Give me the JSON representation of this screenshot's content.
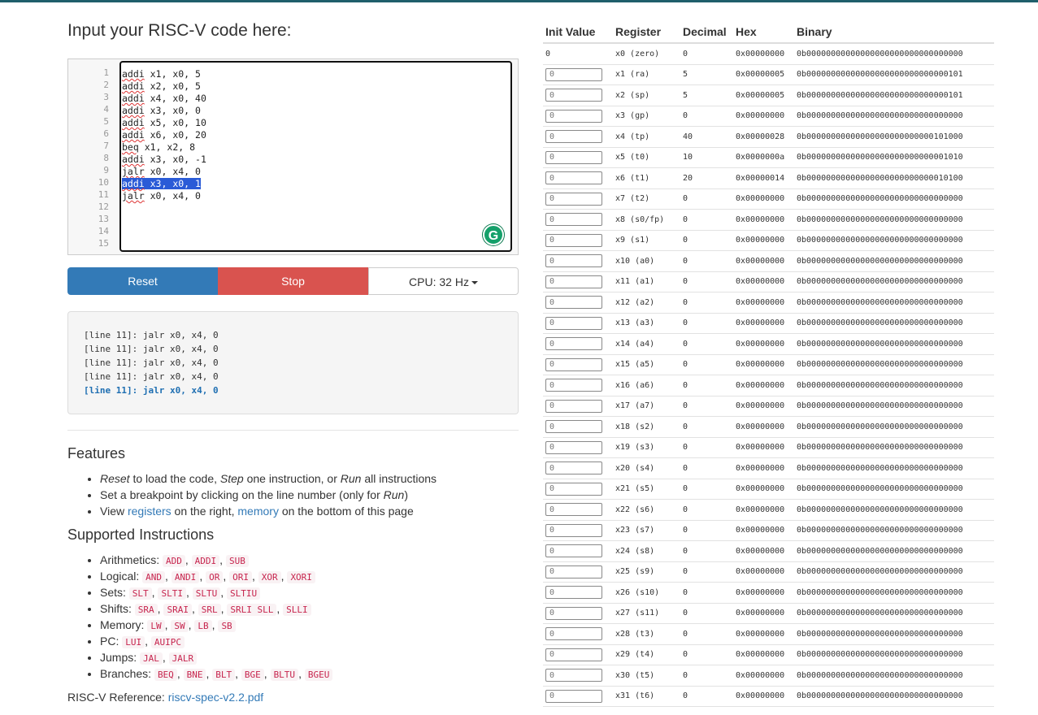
{
  "title": "Input your RISC-V code here:",
  "editor": {
    "line_numbers": [
      "1",
      "2",
      "3",
      "4",
      "5",
      "6",
      "7",
      "8",
      "9",
      "10",
      "11",
      "12",
      "13",
      "14",
      "15"
    ],
    "lines": [
      {
        "kw": "addi",
        "rest": " x1, x0, 5"
      },
      {
        "kw": "addi",
        "rest": " x2, x0, 5"
      },
      {
        "kw": "addi",
        "rest": " x4, x0, 40"
      },
      {
        "kw": "addi",
        "rest": " x3, x0, 0"
      },
      {
        "kw": "addi",
        "rest": " x5, x0, 10"
      },
      {
        "kw": "addi",
        "rest": " x6, x0, 20"
      },
      {
        "kw": "beq",
        "rest": " x1, x2, 8"
      },
      {
        "kw": "addi",
        "rest": " x3, x0, -1"
      },
      {
        "kw": "jalr",
        "rest": " x0, x4, 0"
      },
      {
        "kw": "addi",
        "rest": " x3, x0, 1",
        "selected": true
      },
      {
        "kw": "jalr",
        "rest": " x0, x4, 0"
      }
    ],
    "grammarly_icon": "G"
  },
  "buttons": {
    "reset": "Reset",
    "stop": "Stop",
    "cpu": "CPU: 32 Hz"
  },
  "console": [
    "[line 11]: jalr x0, x4, 0",
    "[line 11]: jalr x0, x4, 0",
    "[line 11]: jalr x0, x4, 0",
    "[line 11]: jalr x0, x4, 0",
    "[line 11]: jalr x0, x4, 0"
  ],
  "features": {
    "title": "Features",
    "item1": {
      "em1": "Reset",
      "t1": " to load the code, ",
      "em2": "Step",
      "t2": " one instruction, or ",
      "em3": "Run",
      "t3": " all instructions"
    },
    "item2": {
      "t1": "Set a breakpoint by clicking on the line number (only for ",
      "em": "Run",
      "t2": ")"
    },
    "item3": {
      "t1": "View ",
      "link1": "registers",
      "t2": " on the right, ",
      "link2": "memory",
      "t3": " on the bottom of this page"
    }
  },
  "instructions": {
    "title": "Supported Instructions",
    "groups": [
      {
        "label": "Arithmetics:",
        "ops": [
          "ADD",
          "ADDI",
          "SUB"
        ]
      },
      {
        "label": "Logical:",
        "ops": [
          "AND",
          "ANDI",
          "OR",
          "ORI",
          "XOR",
          "XORI"
        ]
      },
      {
        "label": "Sets:",
        "ops": [
          "SLT",
          "SLTI",
          "SLTU",
          "SLTIU"
        ]
      },
      {
        "label": "Shifts:",
        "ops": [
          "SRA",
          "SRAI",
          "SRL",
          "SRLI SLL",
          "SLLI"
        ]
      },
      {
        "label": "Memory:",
        "ops": [
          "LW",
          "SW",
          "LB",
          "SB"
        ]
      },
      {
        "label": "PC:",
        "ops": [
          "LUI",
          "AUIPC"
        ]
      },
      {
        "label": "Jumps:",
        "ops": [
          "JAL",
          "JALR"
        ]
      },
      {
        "label": "Branches:",
        "ops": [
          "BEQ",
          "BNE",
          "BLT",
          "BGE",
          "BLTU",
          "BGEU"
        ]
      }
    ]
  },
  "reference": {
    "label": "RISC-V Reference: ",
    "link": "riscv-spec-v2.2.pdf"
  },
  "registers": {
    "headers": {
      "init": "Init Value",
      "reg": "Register",
      "dec": "Decimal",
      "hex": "Hex",
      "bin": "Binary"
    },
    "rows": [
      {
        "init": "0",
        "name": "x0 (zero)",
        "dec": "0",
        "hex": "0x00000000",
        "bin": "0b00000000000000000000000000000000",
        "editable": false
      },
      {
        "init": "0",
        "name": "x1 (ra)",
        "dec": "5",
        "hex": "0x00000005",
        "bin": "0b00000000000000000000000000000101",
        "editable": true
      },
      {
        "init": "0",
        "name": "x2 (sp)",
        "dec": "5",
        "hex": "0x00000005",
        "bin": "0b00000000000000000000000000000101",
        "editable": true
      },
      {
        "init": "0",
        "name": "x3 (gp)",
        "dec": "0",
        "hex": "0x00000000",
        "bin": "0b00000000000000000000000000000000",
        "editable": true
      },
      {
        "init": "0",
        "name": "x4 (tp)",
        "dec": "40",
        "hex": "0x00000028",
        "bin": "0b00000000000000000000000000101000",
        "editable": true
      },
      {
        "init": "0",
        "name": "x5 (t0)",
        "dec": "10",
        "hex": "0x0000000a",
        "bin": "0b00000000000000000000000000001010",
        "editable": true
      },
      {
        "init": "0",
        "name": "x6 (t1)",
        "dec": "20",
        "hex": "0x00000014",
        "bin": "0b00000000000000000000000000010100",
        "editable": true
      },
      {
        "init": "0",
        "name": "x7 (t2)",
        "dec": "0",
        "hex": "0x00000000",
        "bin": "0b00000000000000000000000000000000",
        "editable": true
      },
      {
        "init": "0",
        "name": "x8 (s0/fp)",
        "dec": "0",
        "hex": "0x00000000",
        "bin": "0b00000000000000000000000000000000",
        "editable": true
      },
      {
        "init": "0",
        "name": "x9 (s1)",
        "dec": "0",
        "hex": "0x00000000",
        "bin": "0b00000000000000000000000000000000",
        "editable": true
      },
      {
        "init": "0",
        "name": "x10 (a0)",
        "dec": "0",
        "hex": "0x00000000",
        "bin": "0b00000000000000000000000000000000",
        "editable": true
      },
      {
        "init": "0",
        "name": "x11 (a1)",
        "dec": "0",
        "hex": "0x00000000",
        "bin": "0b00000000000000000000000000000000",
        "editable": true
      },
      {
        "init": "0",
        "name": "x12 (a2)",
        "dec": "0",
        "hex": "0x00000000",
        "bin": "0b00000000000000000000000000000000",
        "editable": true
      },
      {
        "init": "0",
        "name": "x13 (a3)",
        "dec": "0",
        "hex": "0x00000000",
        "bin": "0b00000000000000000000000000000000",
        "editable": true
      },
      {
        "init": "0",
        "name": "x14 (a4)",
        "dec": "0",
        "hex": "0x00000000",
        "bin": "0b00000000000000000000000000000000",
        "editable": true
      },
      {
        "init": "0",
        "name": "x15 (a5)",
        "dec": "0",
        "hex": "0x00000000",
        "bin": "0b00000000000000000000000000000000",
        "editable": true
      },
      {
        "init": "0",
        "name": "x16 (a6)",
        "dec": "0",
        "hex": "0x00000000",
        "bin": "0b00000000000000000000000000000000",
        "editable": true
      },
      {
        "init": "0",
        "name": "x17 (a7)",
        "dec": "0",
        "hex": "0x00000000",
        "bin": "0b00000000000000000000000000000000",
        "editable": true
      },
      {
        "init": "0",
        "name": "x18 (s2)",
        "dec": "0",
        "hex": "0x00000000",
        "bin": "0b00000000000000000000000000000000",
        "editable": true
      },
      {
        "init": "0",
        "name": "x19 (s3)",
        "dec": "0",
        "hex": "0x00000000",
        "bin": "0b00000000000000000000000000000000",
        "editable": true
      },
      {
        "init": "0",
        "name": "x20 (s4)",
        "dec": "0",
        "hex": "0x00000000",
        "bin": "0b00000000000000000000000000000000",
        "editable": true
      },
      {
        "init": "0",
        "name": "x21 (s5)",
        "dec": "0",
        "hex": "0x00000000",
        "bin": "0b00000000000000000000000000000000",
        "editable": true
      },
      {
        "init": "0",
        "name": "x22 (s6)",
        "dec": "0",
        "hex": "0x00000000",
        "bin": "0b00000000000000000000000000000000",
        "editable": true
      },
      {
        "init": "0",
        "name": "x23 (s7)",
        "dec": "0",
        "hex": "0x00000000",
        "bin": "0b00000000000000000000000000000000",
        "editable": true
      },
      {
        "init": "0",
        "name": "x24 (s8)",
        "dec": "0",
        "hex": "0x00000000",
        "bin": "0b00000000000000000000000000000000",
        "editable": true
      },
      {
        "init": "0",
        "name": "x25 (s9)",
        "dec": "0",
        "hex": "0x00000000",
        "bin": "0b00000000000000000000000000000000",
        "editable": true
      },
      {
        "init": "0",
        "name": "x26 (s10)",
        "dec": "0",
        "hex": "0x00000000",
        "bin": "0b00000000000000000000000000000000",
        "editable": true
      },
      {
        "init": "0",
        "name": "x27 (s11)",
        "dec": "0",
        "hex": "0x00000000",
        "bin": "0b00000000000000000000000000000000",
        "editable": true
      },
      {
        "init": "0",
        "name": "x28 (t3)",
        "dec": "0",
        "hex": "0x00000000",
        "bin": "0b00000000000000000000000000000000",
        "editable": true
      },
      {
        "init": "0",
        "name": "x29 (t4)",
        "dec": "0",
        "hex": "0x00000000",
        "bin": "0b00000000000000000000000000000000",
        "editable": true
      },
      {
        "init": "0",
        "name": "x30 (t5)",
        "dec": "0",
        "hex": "0x00000000",
        "bin": "0b00000000000000000000000000000000",
        "editable": true
      },
      {
        "init": "0",
        "name": "x31 (t6)",
        "dec": "0",
        "hex": "0x00000000",
        "bin": "0b00000000000000000000000000000000",
        "editable": true
      }
    ]
  }
}
